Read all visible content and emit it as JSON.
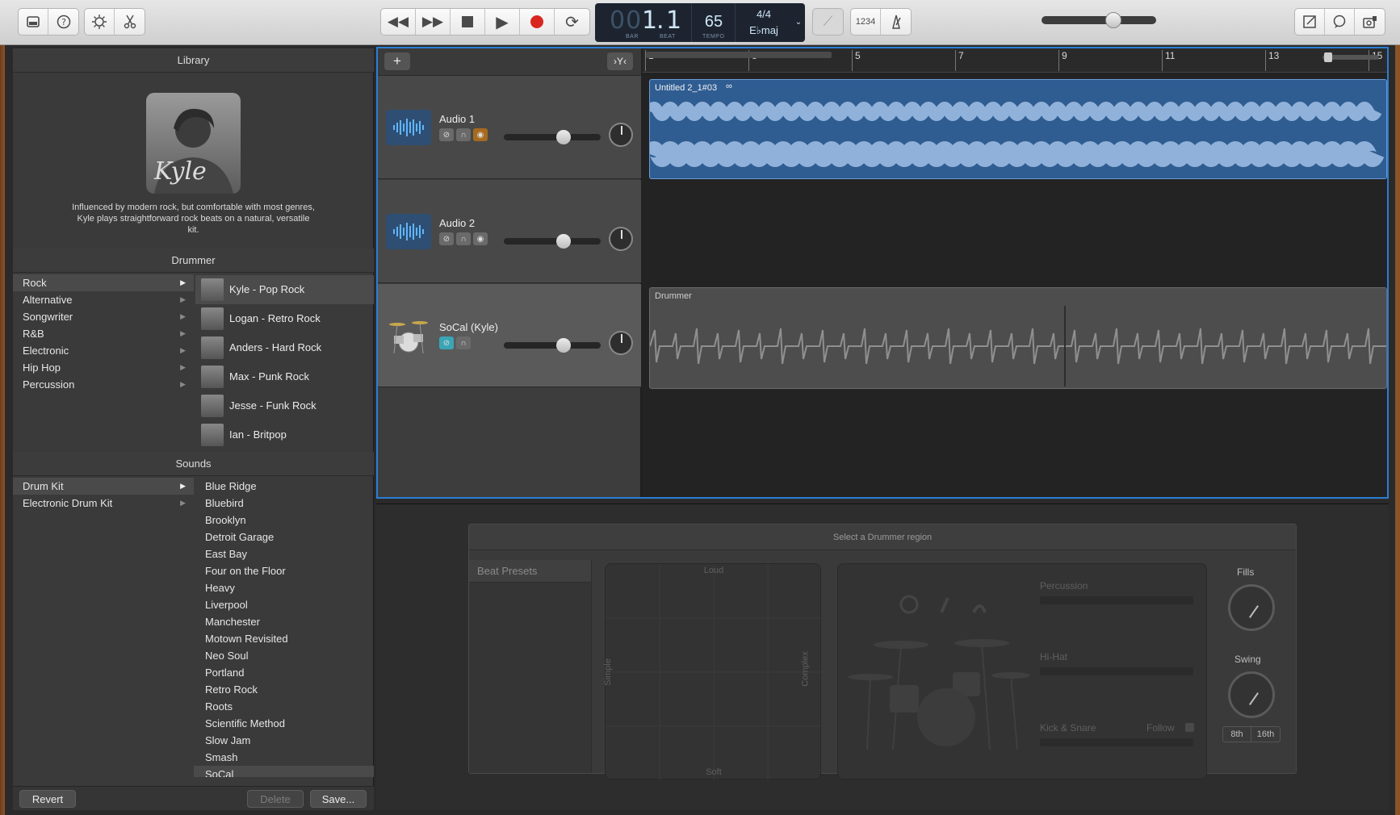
{
  "toolbar": {
    "lcd": {
      "bar_dim": "00",
      "bar": "1",
      "beat": "1",
      "bar_label": "BAR",
      "beat_label": "BEAT",
      "tempo": "65",
      "tempo_label": "TEMPO",
      "signature": "4/4",
      "key": "E♭maj"
    },
    "count_in": "1234",
    "master_volume_level": 0.65
  },
  "library": {
    "title": "Library",
    "drummer_portrait_name": "Kyle",
    "description": "Influenced by modern rock, but comfortable with most genres, Kyle plays straightforward rock beats on a natural, versatile kit.",
    "drummer_header": "Drummer",
    "genres": [
      "Rock",
      "Alternative",
      "Songwriter",
      "R&B",
      "Electronic",
      "Hip Hop",
      "Percussion"
    ],
    "drummers": [
      "Kyle - Pop Rock",
      "Logan - Retro Rock",
      "Anders - Hard Rock",
      "Max - Punk Rock",
      "Jesse - Funk Rock",
      "Ian - Britpop"
    ],
    "sounds_header": "Sounds",
    "kit_types": [
      "Drum Kit",
      "Electronic Drum Kit"
    ],
    "sounds": [
      "Blue Ridge",
      "Bluebird",
      "Brooklyn",
      "Detroit Garage",
      "East Bay",
      "Four on the Floor",
      "Heavy",
      "Liverpool",
      "Manchester",
      "Motown Revisited",
      "Neo Soul",
      "Portland",
      "Retro Rock",
      "Roots",
      "Scientific Method",
      "Slow Jam",
      "Smash",
      "SoCal"
    ],
    "revert": "Revert",
    "delete": "Delete",
    "save": "Save..."
  },
  "tracks": {
    "add": "+",
    "ruler": [
      "1",
      "3",
      "5",
      "7",
      "9",
      "11",
      "13",
      "15"
    ],
    "list": [
      {
        "name": "Audio 1",
        "volume": 0.64
      },
      {
        "name": "Audio 2",
        "volume": 0.64
      },
      {
        "name": "SoCal (Kyle)",
        "volume": 0.64
      }
    ],
    "regions": {
      "audio": "Untitled 2_1#03",
      "drummer": "Drummer"
    }
  },
  "editor": {
    "message": "Select a Drummer region",
    "beat_presets": "Beat Presets",
    "loud": "Loud",
    "soft": "Soft",
    "simple": "Simple",
    "complex": "Complex",
    "percussion": "Percussion",
    "hihat": "Hi-Hat",
    "kick_snare": "Kick & Snare",
    "follow": "Follow",
    "fills": "Fills",
    "swing": "Swing",
    "eighth": "8th",
    "sixteenth": "16th"
  }
}
